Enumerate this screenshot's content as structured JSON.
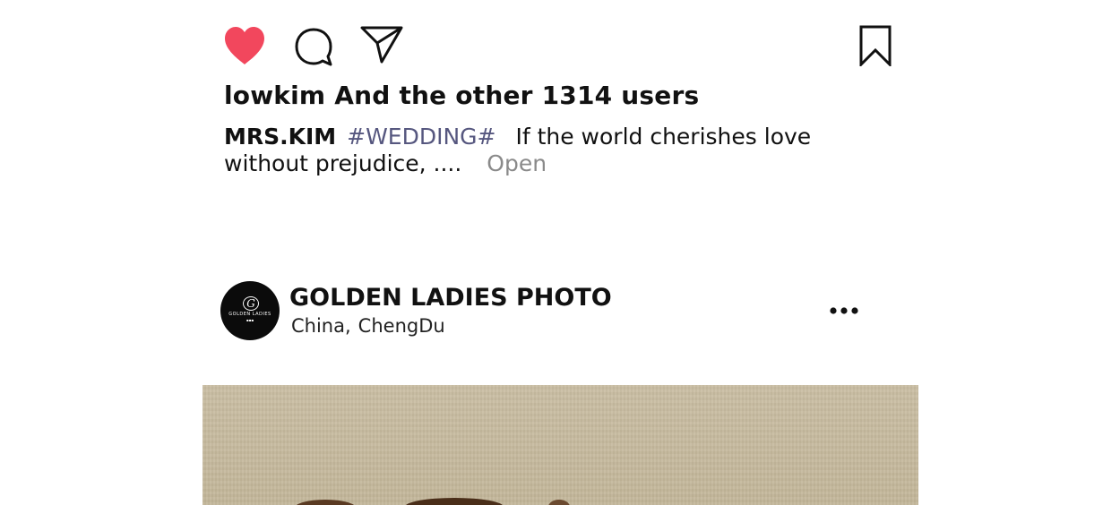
{
  "post_actions": {
    "like_icon": "heart-filled-icon",
    "comment_icon": "speech-bubble-icon",
    "share_icon": "paper-plane-icon",
    "bookmark_icon": "bookmark-icon",
    "like_color": "#f2475d",
    "icon_color": "#111111"
  },
  "likes": {
    "user": "lowkim",
    "rest": "And the other 1314 users"
  },
  "caption": {
    "author": "MRS.KIM",
    "hashtag": "#WEDDING#",
    "text": "If the world cherishes love without prejudice, ....",
    "more_label": "Open",
    "hashtag_color": "#56577f"
  },
  "next_post": {
    "avatar_logo_text": "GOLDEN LADIES",
    "account_name": "GOLDEN LADIES PHOTO",
    "location_country": "China,",
    "location_city": "ChengDu",
    "more_icon": "more-horizontal-icon"
  }
}
